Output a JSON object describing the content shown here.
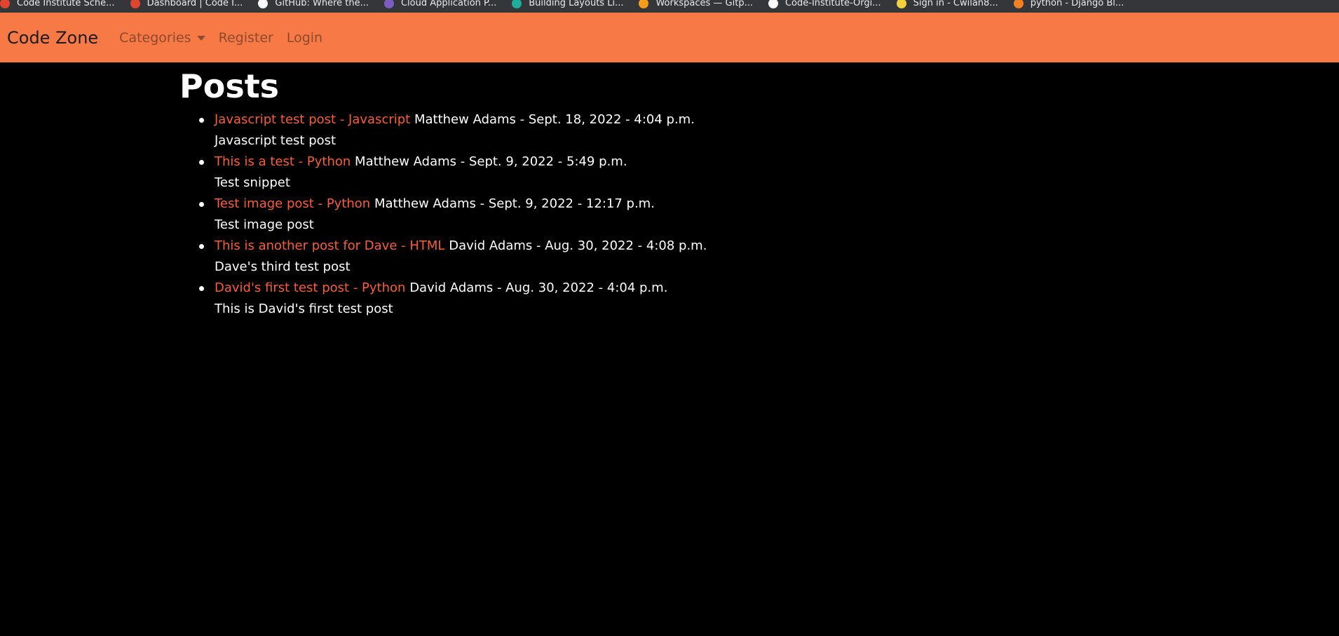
{
  "bookmarks": [
    {
      "label": "Code Institute Sche...",
      "icon": "code-institute-icon",
      "color": "#e2452f"
    },
    {
      "label": "Dashboard | Code I...",
      "icon": "code-institute-icon",
      "color": "#e2452f"
    },
    {
      "label": "GitHub: Where the...",
      "icon": "github-icon",
      "color": "#ffffff"
    },
    {
      "label": "Cloud Application P...",
      "icon": "heroku-icon",
      "color": "#7b5cc1"
    },
    {
      "label": "Building Layouts Li...",
      "icon": "circle-icon",
      "color": "#1fae9b"
    },
    {
      "label": "Workspaces — Gitp...",
      "icon": "gitpod-icon",
      "color": "#f59c1a"
    },
    {
      "label": "Code-Institute-Orgi...",
      "icon": "github-icon",
      "color": "#ffffff"
    },
    {
      "label": "Sign in - Cwilan8...",
      "icon": "sign-in-icon",
      "color": "#f4d03f"
    },
    {
      "label": "python - Django Bl...",
      "icon": "stackoverflow-icon",
      "color": "#f48024"
    }
  ],
  "navbar": {
    "brand": "Code Zone",
    "categories_label": "Categories",
    "register_label": "Register",
    "login_label": "Login",
    "background": "#f77945"
  },
  "page": {
    "title": "Posts"
  },
  "posts": [
    {
      "title": "Javascript test post",
      "category": "Javascript",
      "meta": "Matthew Adams - Sept. 18, 2022 - 4:04 p.m.",
      "snippet": "Javascript test post"
    },
    {
      "title": "This is a test",
      "category": "Python",
      "meta": "Matthew Adams - Sept. 9, 2022 - 5:49 p.m.",
      "snippet": "Test snippet"
    },
    {
      "title": "Test image post",
      "category": "Python",
      "meta": "Matthew Adams - Sept. 9, 2022 - 12:17 p.m.",
      "snippet": "Test image post"
    },
    {
      "title": "This is another post for Dave",
      "category": "HTML",
      "meta": "David Adams - Aug. 30, 2022 - 4:08 p.m.",
      "snippet": "Dave's third test post"
    },
    {
      "title": "David's first test post",
      "category": "Python",
      "meta": "David Adams - Aug. 30, 2022 - 4:04 p.m.",
      "snippet": "This is David's first test post"
    }
  ],
  "separator": "-",
  "colors": {
    "link": "#fb5d33",
    "background": "#000000"
  }
}
